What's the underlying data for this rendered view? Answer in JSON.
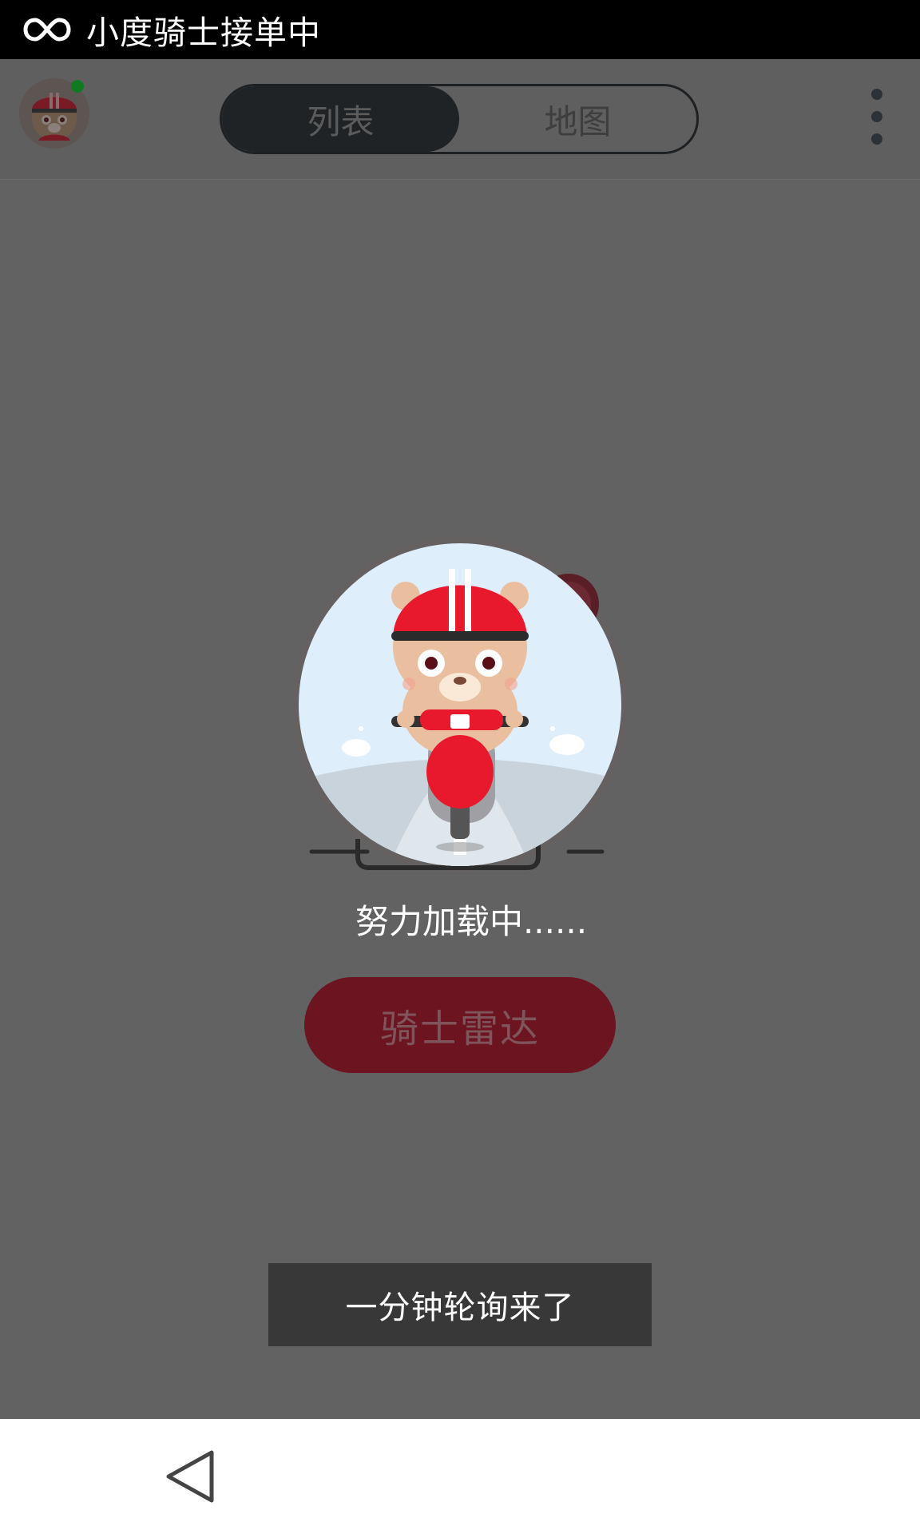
{
  "status_bar": {
    "icon": "infinity-icon",
    "title": "小度骑士接单中"
  },
  "app_bar": {
    "avatar": "rider-bear-avatar",
    "online_status_color": "#0f7a1f",
    "tabs": [
      {
        "label": "列表",
        "active": true
      },
      {
        "label": "地图",
        "active": false
      }
    ],
    "menu_icon": "more-vertical-icon"
  },
  "main": {
    "illustration": "bear-on-scooter",
    "loading_text": "努力加载中......",
    "radar_button_label": "骑士雷达"
  },
  "toast": {
    "message": "一分钟轮询来了"
  },
  "nav_bar": {
    "back_icon": "back-triangle-icon"
  },
  "colors": {
    "accent_red": "#e8192c",
    "overlay": "#636262"
  }
}
